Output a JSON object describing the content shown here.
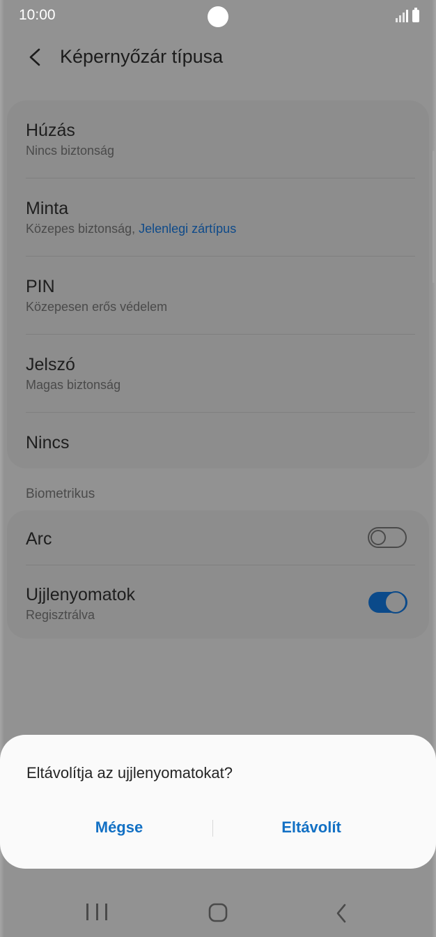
{
  "status_bar": {
    "time": "10:00"
  },
  "header": {
    "title": "Képernyőzár típusa"
  },
  "lock_types": [
    {
      "title": "Húzás",
      "subtitle": "Nincs biztonság",
      "accent": ""
    },
    {
      "title": "Minta",
      "subtitle": "Közepes biztonság, ",
      "accent": "Jelenlegi zártípus"
    },
    {
      "title": "PIN",
      "subtitle": "Közepesen erős védelem",
      "accent": ""
    },
    {
      "title": "Jelszó",
      "subtitle": "Magas biztonság",
      "accent": ""
    },
    {
      "title": "Nincs",
      "subtitle": "",
      "accent": ""
    }
  ],
  "biometrics": {
    "section_label": "Biometrikus",
    "items": [
      {
        "title": "Arc",
        "subtitle": "",
        "enabled": false
      },
      {
        "title": "Ujjlenyomatok",
        "subtitle": "Regisztrálva",
        "enabled": true
      }
    ]
  },
  "dialog": {
    "message": "Eltávolítja az ujjlenyomatokat?",
    "cancel_label": "Mégse",
    "confirm_label": "Eltávolít"
  },
  "colors": {
    "accent": "#1270c4",
    "toggle_on": "#0b4a8a",
    "scrim_background": "#929292"
  },
  "nav_bar": {
    "icons": [
      "recent-apps-icon",
      "home-icon",
      "back-icon"
    ]
  }
}
